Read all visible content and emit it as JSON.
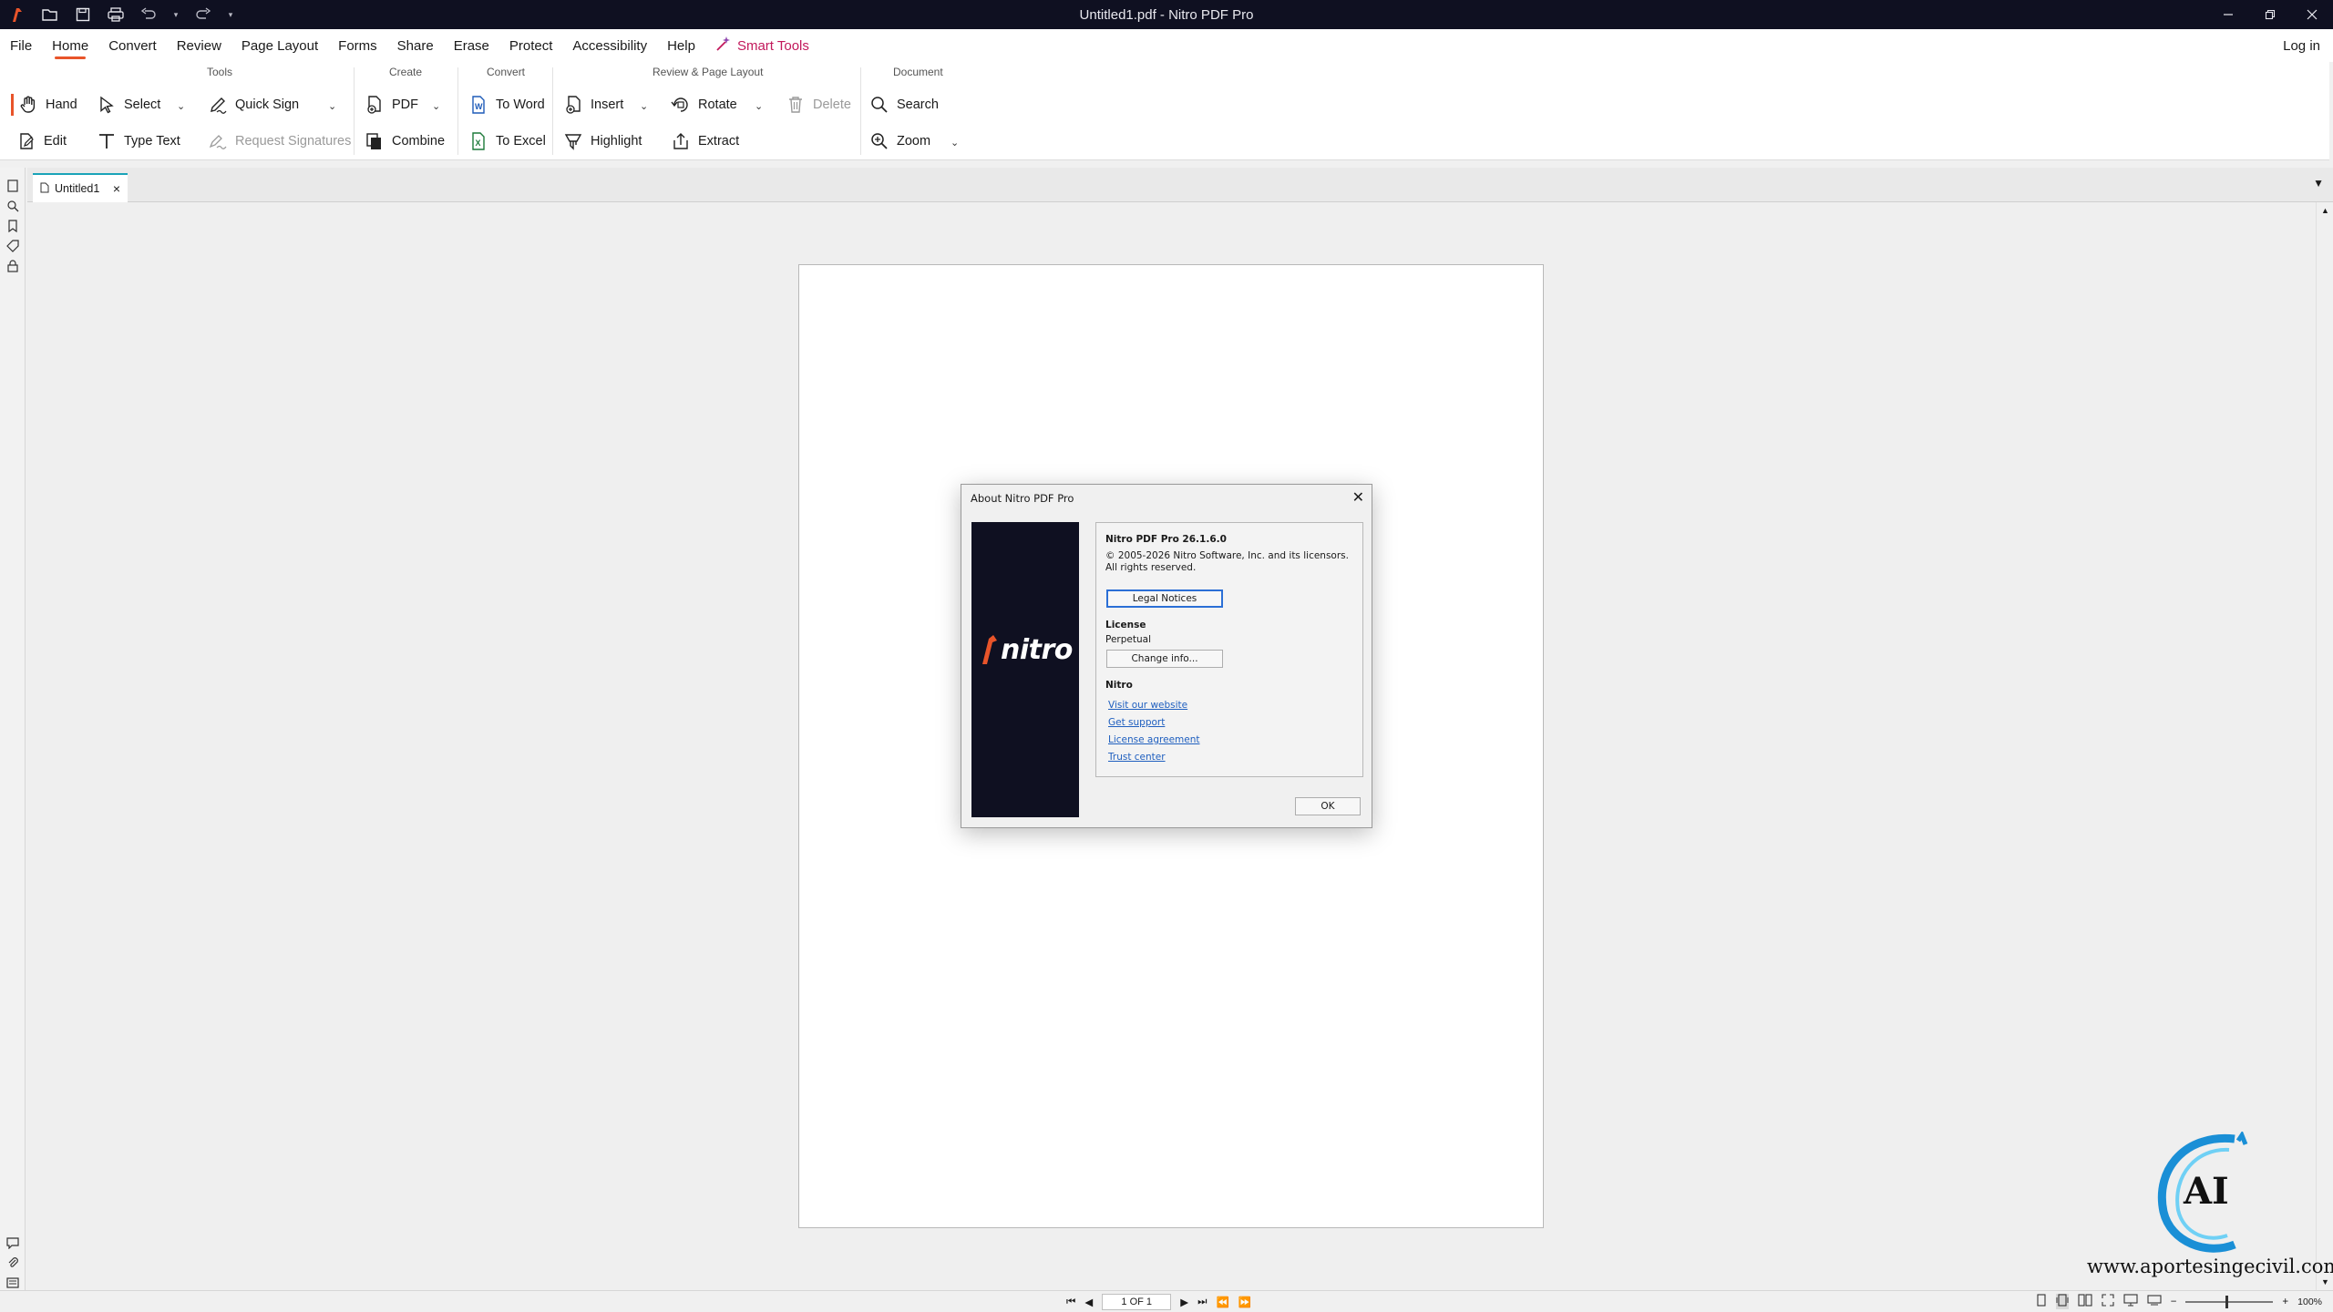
{
  "window": {
    "title": "Untitled1.pdf - Nitro PDF Pro",
    "controls": [
      "minimize-icon",
      "restore-icon",
      "close-icon"
    ]
  },
  "menu": {
    "items": [
      "File",
      "Home",
      "Convert",
      "Review",
      "Page Layout",
      "Forms",
      "Share",
      "Erase",
      "Protect",
      "Accessibility",
      "Help"
    ],
    "active": "Home",
    "smart_tools": "Smart Tools",
    "login": "Log in"
  },
  "ribbon": {
    "groups": {
      "tools": "Tools",
      "create": "Create",
      "convert": "Convert",
      "review_layout": "Review & Page Layout",
      "document": "Document"
    },
    "buttons": {
      "hand": "Hand",
      "select": "Select",
      "quick_sign": "Quick Sign",
      "edit": "Edit",
      "type_text": "Type Text",
      "request_signatures": "Request Signatures",
      "pdf": "PDF",
      "combine": "Combine",
      "to_word": "To Word",
      "to_excel": "To Excel",
      "insert": "Insert",
      "rotate": "Rotate",
      "delete": "Delete",
      "highlight": "Highlight",
      "extract": "Extract",
      "search": "Search",
      "zoom": "Zoom"
    }
  },
  "tabs": [
    {
      "label": "Untitled1",
      "active": true
    }
  ],
  "about_dialog": {
    "title": "About Nitro PDF Pro",
    "brand_text": "nitro",
    "product": "Nitro PDF Pro 26.1.6.0",
    "copyright_line1": "© 2005-2026 Nitro Software, Inc. and its licensors.",
    "copyright_line2": "All rights reserved.",
    "legal_notices_button": "Legal Notices",
    "license_heading": "License",
    "license_value": "Perpetual",
    "change_info_button": "Change info...",
    "nitro_heading": "Nitro",
    "links": {
      "website": "Visit our website",
      "support": "Get support",
      "license_agreement": "License agreement",
      "trust_center": "Trust center"
    },
    "ok_button": "OK"
  },
  "status": {
    "page_indicator": "1 OF 1",
    "zoom": "100%"
  },
  "watermark": {
    "initials": "AI",
    "url": "www.aportesingecivil.com"
  },
  "colors": {
    "titlebar": "#0f1021",
    "accent": "#e8542a",
    "smart_tools": "#c2185b",
    "tab_accent": "#1aa3b8",
    "link": "#1f5fbf"
  }
}
